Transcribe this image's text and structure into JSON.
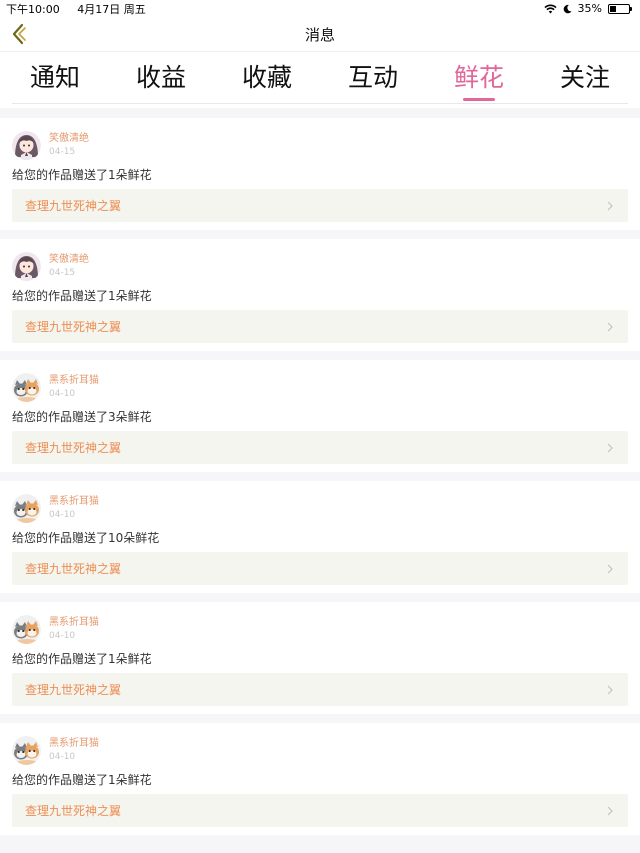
{
  "status_bar": {
    "time": "下午10:00",
    "date": "4月17日 周五",
    "battery": "35%",
    "battery_level": 0.35
  },
  "nav": {
    "title": "消息",
    "back_icon": "chevron-left-icon",
    "accent": "#e0679a"
  },
  "tabs": [
    {
      "label": "通知",
      "active": false
    },
    {
      "label": "收益",
      "active": false
    },
    {
      "label": "收藏",
      "active": false
    },
    {
      "label": "互动",
      "active": false
    },
    {
      "label": "鲜花",
      "active": true
    },
    {
      "label": "关注",
      "active": false
    }
  ],
  "notifications": [
    {
      "user": "笑傲清绝",
      "date": "04-15",
      "message": "给您的作品赠送了1朵鲜花",
      "work": "查理九世死神之翼",
      "avatar": "girl"
    },
    {
      "user": "笑傲清绝",
      "date": "04-15",
      "message": "给您的作品赠送了1朵鲜花",
      "work": "查理九世死神之翼",
      "avatar": "girl"
    },
    {
      "user": "黑系折耳猫",
      "date": "04-10",
      "message": "给您的作品赠送了3朵鲜花",
      "work": "查理九世死神之翼",
      "avatar": "cats"
    },
    {
      "user": "黑系折耳猫",
      "date": "04-10",
      "message": "给您的作品赠送了10朵鲜花",
      "work": "查理九世死神之翼",
      "avatar": "cats"
    },
    {
      "user": "黑系折耳猫",
      "date": "04-10",
      "message": "给您的作品赠送了1朵鲜花",
      "work": "查理九世死神之翼",
      "avatar": "cats"
    },
    {
      "user": "黑系折耳猫",
      "date": "04-10",
      "message": "给您的作品赠送了1朵鲜花",
      "work": "查理九世死神之翼",
      "avatar": "cats"
    }
  ]
}
